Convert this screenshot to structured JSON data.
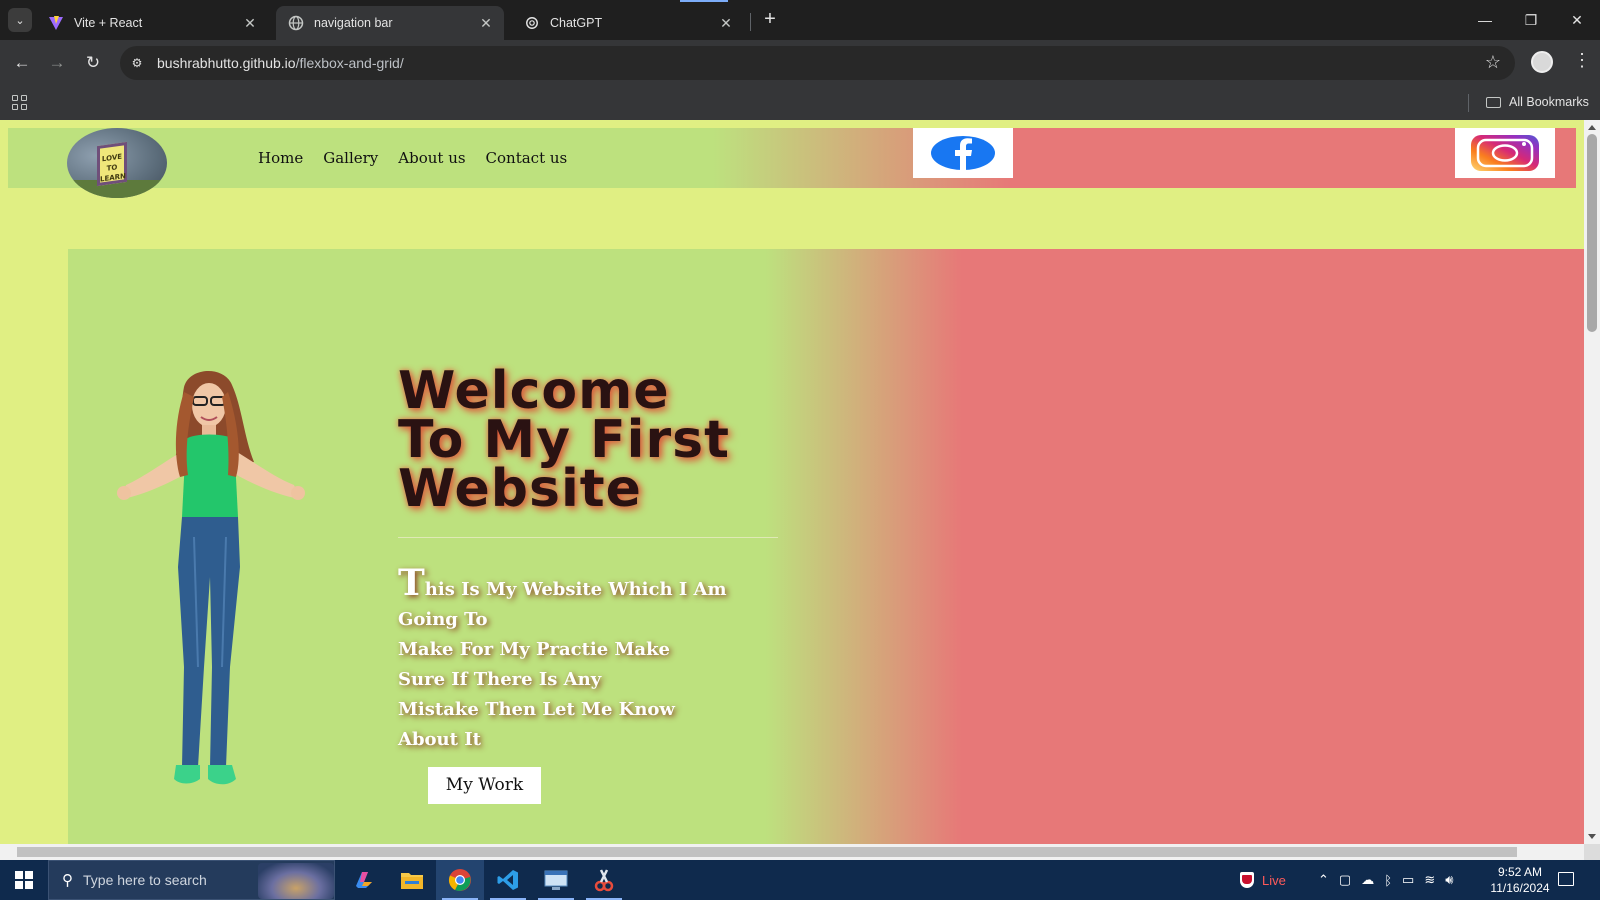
{
  "browser": {
    "tabs": [
      {
        "title": "Vite + React",
        "favicon": "vite-icon",
        "active": false
      },
      {
        "title": "navigation bar",
        "favicon": "globe-icon",
        "active": true
      },
      {
        "title": "ChatGPT",
        "favicon": "chatgpt-icon",
        "active": false
      }
    ],
    "url_host": "bushrabhutto.github.io",
    "url_path": "/flexbox-and-grid/",
    "bookmarks_label": "All Bookmarks"
  },
  "site": {
    "logo_text": "LOVE TO LEARN",
    "nav": [
      "Home",
      "Gallery",
      "About us",
      "Contact us"
    ],
    "social": [
      "facebook-icon",
      "instagram-icon"
    ],
    "hero": {
      "title_lines": [
        "Welcome",
        "To My First",
        "Website"
      ],
      "para_first_letter": "T",
      "para_rest_first_line": "his Is My Website Which I Am Going To",
      "para_lines": [
        "Make For My Practie Make",
        "Sure If There Is Any",
        "Mistake Then Let Me Know",
        "About It"
      ],
      "button": "My Work"
    },
    "colors": {
      "green": "#bde17e",
      "red": "#e77878",
      "page_bg": "#e0ef83"
    }
  },
  "taskbar": {
    "search_placeholder": "Type here to search",
    "live_label": "Live",
    "time": "9:52 AM",
    "date": "11/16/2024"
  }
}
